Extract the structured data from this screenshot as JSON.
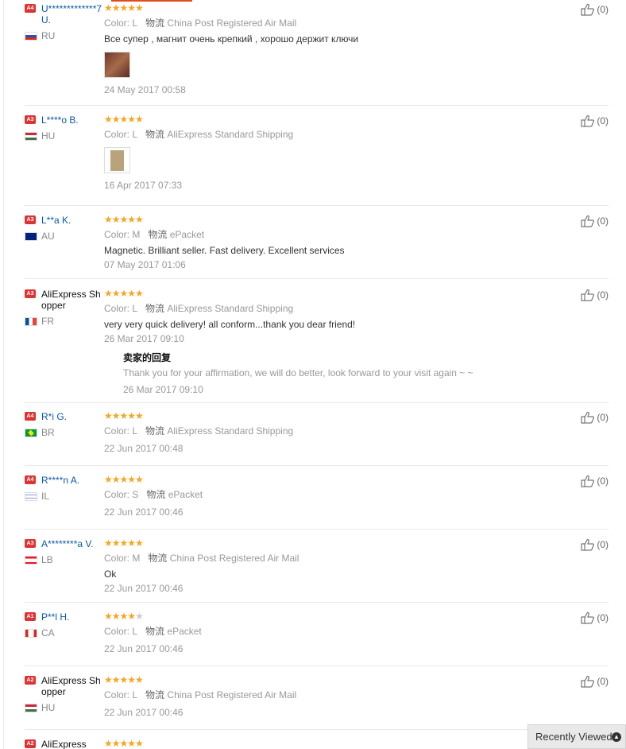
{
  "common": {
    "color_label": "Color:",
    "ship_label": "物流",
    "rating_stars": "★★★★★"
  },
  "reviews": [
    {
      "badge": "A4",
      "user_name": "U*************7U.",
      "country": "RU",
      "color": "L",
      "shipping": "China Post Registered Air Mail",
      "text": "Все супер , магнит очень крепкий , хорошо держит ключи",
      "has_photo": true,
      "date": "24 May 2017 00:58",
      "likes": "(0)"
    },
    {
      "badge": "A3",
      "user_name": "L****o B.",
      "country": "HU",
      "color": "L",
      "shipping": "AliExpress Standard Shipping",
      "text": "",
      "has_photo": true,
      "date": "16 Apr 2017 07:33",
      "likes": "(0)"
    },
    {
      "badge": "A3",
      "user_name": "L**a K.",
      "country": "AU",
      "color": "M",
      "shipping": "ePacket",
      "text": "Magnetic. Brilliant seller. Fast delivery. Excellent services",
      "date": "07 May 2017 01:06",
      "likes": "(0)"
    },
    {
      "badge": "A3",
      "user_name": "AliExpress Shopper",
      "country": "FR",
      "color": "L",
      "shipping": "AliExpress Standard Shipping",
      "text": "very very quick delivery! all conform...thank you dear friend!",
      "date": "26 Mar 2017 09:10",
      "reply": {
        "title": "卖家的回复",
        "text": "Thank you for your affirmation, we will do better, look forward to your visit again ~ ~",
        "date": "26 Mar 2017 09:10"
      },
      "likes": "(0)"
    },
    {
      "badge": "A4",
      "user_name": "R*i G.",
      "country": "BR",
      "color": "L",
      "shipping": "AliExpress Standard Shipping",
      "text": "",
      "date": "22 Jun 2017 00:48",
      "likes": "(0)"
    },
    {
      "badge": "A4",
      "user_name": "R****n A.",
      "country": "IL",
      "color": "S",
      "shipping": "ePacket",
      "text": "",
      "date": "22 Jun 2017 00:46",
      "likes": "(0)"
    },
    {
      "badge": "A3",
      "user_name": "A********a V.",
      "country": "LB",
      "color": "M",
      "shipping": "China Post Registered Air Mail",
      "text": "Ok",
      "date": "22 Jun 2017 00:46",
      "likes": "(0)"
    },
    {
      "badge": "A1",
      "user_name": "P**l H.",
      "country": "CA",
      "rating": 4,
      "color": "L",
      "shipping": "ePacket",
      "text": "",
      "date": "22 Jun 2017 00:46",
      "likes": "(0)"
    },
    {
      "badge": "A2",
      "user_name": "AliExpress Shopper",
      "country": "HU",
      "color": "L",
      "shipping": "China Post Registered Air Mail",
      "text": "",
      "date": "22 Jun 2017 00:46",
      "likes": "(0)"
    },
    {
      "badge": "A2",
      "user_name": "AliExpress",
      "country": "",
      "likes": ""
    }
  ],
  "recently_viewed": {
    "label": "Recently Viewed"
  }
}
